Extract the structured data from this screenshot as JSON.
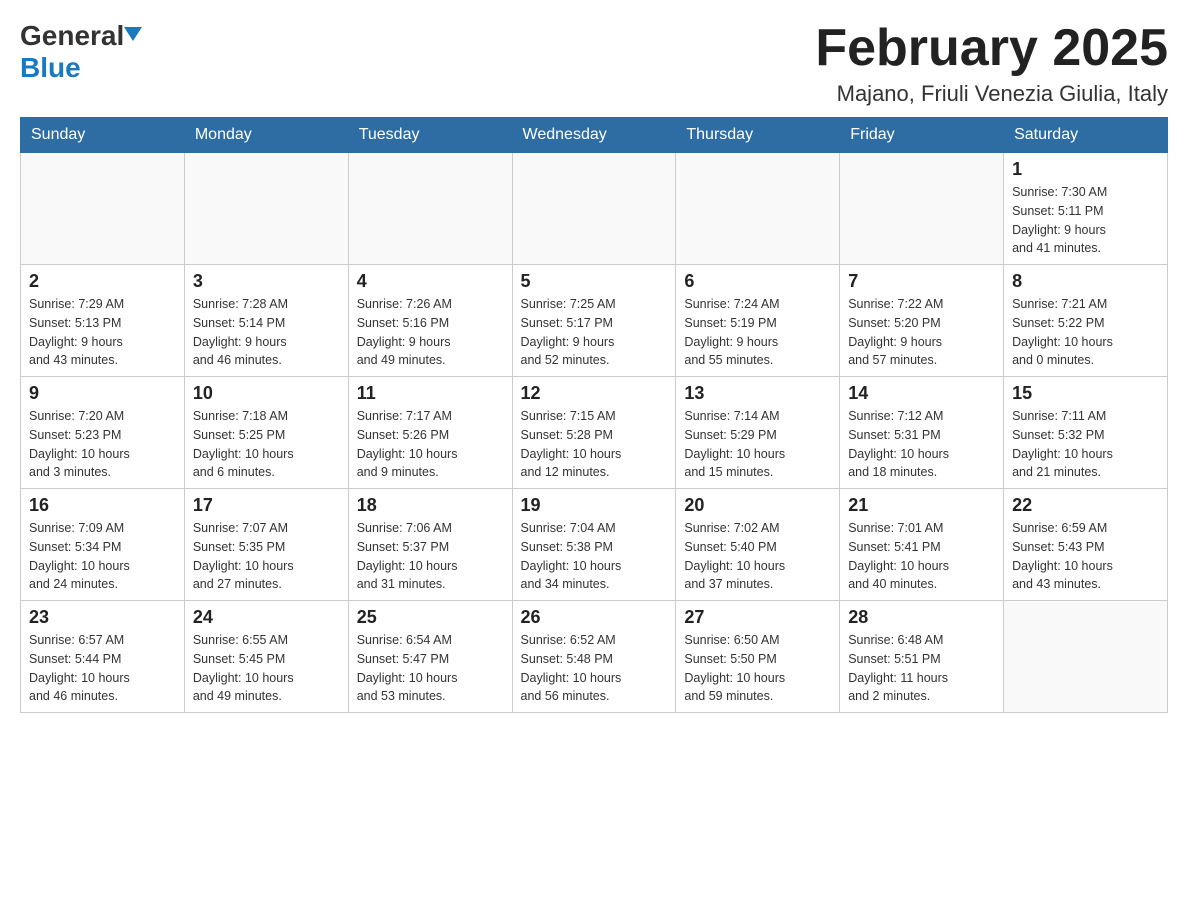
{
  "header": {
    "logo_general": "General",
    "logo_blue": "Blue",
    "month_title": "February 2025",
    "location": "Majano, Friuli Venezia Giulia, Italy"
  },
  "days_of_week": [
    "Sunday",
    "Monday",
    "Tuesday",
    "Wednesday",
    "Thursday",
    "Friday",
    "Saturday"
  ],
  "weeks": [
    {
      "days": [
        {
          "number": "",
          "info": ""
        },
        {
          "number": "",
          "info": ""
        },
        {
          "number": "",
          "info": ""
        },
        {
          "number": "",
          "info": ""
        },
        {
          "number": "",
          "info": ""
        },
        {
          "number": "",
          "info": ""
        },
        {
          "number": "1",
          "info": "Sunrise: 7:30 AM\nSunset: 5:11 PM\nDaylight: 9 hours\nand 41 minutes."
        }
      ]
    },
    {
      "days": [
        {
          "number": "2",
          "info": "Sunrise: 7:29 AM\nSunset: 5:13 PM\nDaylight: 9 hours\nand 43 minutes."
        },
        {
          "number": "3",
          "info": "Sunrise: 7:28 AM\nSunset: 5:14 PM\nDaylight: 9 hours\nand 46 minutes."
        },
        {
          "number": "4",
          "info": "Sunrise: 7:26 AM\nSunset: 5:16 PM\nDaylight: 9 hours\nand 49 minutes."
        },
        {
          "number": "5",
          "info": "Sunrise: 7:25 AM\nSunset: 5:17 PM\nDaylight: 9 hours\nand 52 minutes."
        },
        {
          "number": "6",
          "info": "Sunrise: 7:24 AM\nSunset: 5:19 PM\nDaylight: 9 hours\nand 55 minutes."
        },
        {
          "number": "7",
          "info": "Sunrise: 7:22 AM\nSunset: 5:20 PM\nDaylight: 9 hours\nand 57 minutes."
        },
        {
          "number": "8",
          "info": "Sunrise: 7:21 AM\nSunset: 5:22 PM\nDaylight: 10 hours\nand 0 minutes."
        }
      ]
    },
    {
      "days": [
        {
          "number": "9",
          "info": "Sunrise: 7:20 AM\nSunset: 5:23 PM\nDaylight: 10 hours\nand 3 minutes."
        },
        {
          "number": "10",
          "info": "Sunrise: 7:18 AM\nSunset: 5:25 PM\nDaylight: 10 hours\nand 6 minutes."
        },
        {
          "number": "11",
          "info": "Sunrise: 7:17 AM\nSunset: 5:26 PM\nDaylight: 10 hours\nand 9 minutes."
        },
        {
          "number": "12",
          "info": "Sunrise: 7:15 AM\nSunset: 5:28 PM\nDaylight: 10 hours\nand 12 minutes."
        },
        {
          "number": "13",
          "info": "Sunrise: 7:14 AM\nSunset: 5:29 PM\nDaylight: 10 hours\nand 15 minutes."
        },
        {
          "number": "14",
          "info": "Sunrise: 7:12 AM\nSunset: 5:31 PM\nDaylight: 10 hours\nand 18 minutes."
        },
        {
          "number": "15",
          "info": "Sunrise: 7:11 AM\nSunset: 5:32 PM\nDaylight: 10 hours\nand 21 minutes."
        }
      ]
    },
    {
      "days": [
        {
          "number": "16",
          "info": "Sunrise: 7:09 AM\nSunset: 5:34 PM\nDaylight: 10 hours\nand 24 minutes."
        },
        {
          "number": "17",
          "info": "Sunrise: 7:07 AM\nSunset: 5:35 PM\nDaylight: 10 hours\nand 27 minutes."
        },
        {
          "number": "18",
          "info": "Sunrise: 7:06 AM\nSunset: 5:37 PM\nDaylight: 10 hours\nand 31 minutes."
        },
        {
          "number": "19",
          "info": "Sunrise: 7:04 AM\nSunset: 5:38 PM\nDaylight: 10 hours\nand 34 minutes."
        },
        {
          "number": "20",
          "info": "Sunrise: 7:02 AM\nSunset: 5:40 PM\nDaylight: 10 hours\nand 37 minutes."
        },
        {
          "number": "21",
          "info": "Sunrise: 7:01 AM\nSunset: 5:41 PM\nDaylight: 10 hours\nand 40 minutes."
        },
        {
          "number": "22",
          "info": "Sunrise: 6:59 AM\nSunset: 5:43 PM\nDaylight: 10 hours\nand 43 minutes."
        }
      ]
    },
    {
      "days": [
        {
          "number": "23",
          "info": "Sunrise: 6:57 AM\nSunset: 5:44 PM\nDaylight: 10 hours\nand 46 minutes."
        },
        {
          "number": "24",
          "info": "Sunrise: 6:55 AM\nSunset: 5:45 PM\nDaylight: 10 hours\nand 49 minutes."
        },
        {
          "number": "25",
          "info": "Sunrise: 6:54 AM\nSunset: 5:47 PM\nDaylight: 10 hours\nand 53 minutes."
        },
        {
          "number": "26",
          "info": "Sunrise: 6:52 AM\nSunset: 5:48 PM\nDaylight: 10 hours\nand 56 minutes."
        },
        {
          "number": "27",
          "info": "Sunrise: 6:50 AM\nSunset: 5:50 PM\nDaylight: 10 hours\nand 59 minutes."
        },
        {
          "number": "28",
          "info": "Sunrise: 6:48 AM\nSunset: 5:51 PM\nDaylight: 11 hours\nand 2 minutes."
        },
        {
          "number": "",
          "info": ""
        }
      ]
    }
  ]
}
